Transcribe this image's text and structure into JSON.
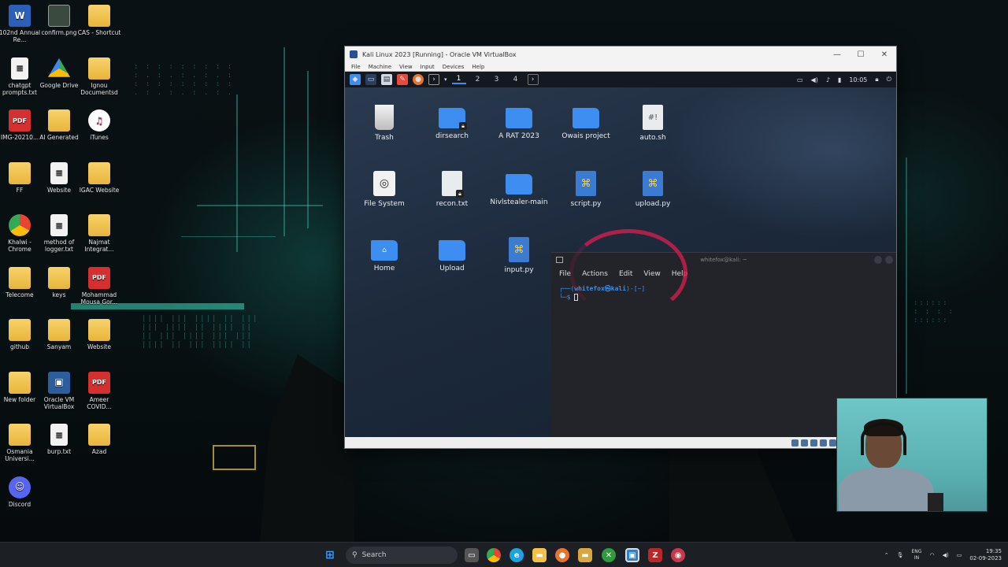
{
  "desktop_icons": [
    {
      "label": "102nd Annual Re...",
      "type": "word"
    },
    {
      "label": "confirm.png",
      "type": "img"
    },
    {
      "label": "CAS - Shortcut",
      "type": "folder"
    },
    {
      "label": "chatgpt prompts.txt",
      "type": "file"
    },
    {
      "label": "Google Drive",
      "type": "drive"
    },
    {
      "label": "Ignou Documentsd",
      "type": "folder"
    },
    {
      "label": "IMG-20210...",
      "type": "pdf"
    },
    {
      "label": "AI Generated",
      "type": "folder"
    },
    {
      "label": "iTunes",
      "type": "itunes"
    },
    {
      "label": "FF",
      "type": "folder"
    },
    {
      "label": "Website",
      "type": "file"
    },
    {
      "label": "IGAC Website",
      "type": "folder"
    },
    {
      "label": "Khalwi - Chrome",
      "type": "chrome"
    },
    {
      "label": "method of logger.txt",
      "type": "file"
    },
    {
      "label": "Najmat Integrat...",
      "type": "folder"
    },
    {
      "label": "Telecome",
      "type": "folder"
    },
    {
      "label": "keys",
      "type": "folder"
    },
    {
      "label": "Mohammad Mousa Gor...",
      "type": "pdf"
    },
    {
      "label": "github",
      "type": "folder"
    },
    {
      "label": "Sanyam",
      "type": "folder"
    },
    {
      "label": "Website",
      "type": "folder"
    },
    {
      "label": "New folder",
      "type": "folder"
    },
    {
      "label": "Oracle VM VirtualBox",
      "type": "box"
    },
    {
      "label": "Ameer COVID...",
      "type": "pdf"
    },
    {
      "label": "Osmania Universi...",
      "type": "folder"
    },
    {
      "label": "burp.txt",
      "type": "file"
    },
    {
      "label": "Azad",
      "type": "folder"
    },
    {
      "label": "Discord",
      "type": "discord"
    }
  ],
  "vbox": {
    "title": "Kali Linux 2023 [Running] - Oracle VM VirtualBox",
    "menu": [
      "File",
      "Machine",
      "View",
      "Input",
      "Devices",
      "Help"
    ],
    "workspaces": [
      "1",
      "2",
      "3",
      "4"
    ],
    "clock": "10:05"
  },
  "kali_icons": [
    {
      "label": "Trash",
      "type": "trash"
    },
    {
      "label": "dirsearch",
      "type": "folder-lock"
    },
    {
      "label": "A RAT 2023",
      "type": "folder"
    },
    {
      "label": "Owais project",
      "type": "folder"
    },
    {
      "label": "auto.sh",
      "type": "file"
    },
    {
      "label": "File System",
      "type": "disk"
    },
    {
      "label": "recon.txt",
      "type": "file-lock"
    },
    {
      "label": "Nivlstealer-main",
      "type": "folder"
    },
    {
      "label": "script.py",
      "type": "py"
    },
    {
      "label": "upload.py",
      "type": "py"
    },
    {
      "label": "Home",
      "type": "home"
    },
    {
      "label": "Upload",
      "type": "folder"
    },
    {
      "label": "input.py",
      "type": "py"
    }
  ],
  "terminal": {
    "title": "whitefox@kali: ~",
    "menu": [
      "File",
      "Actions",
      "Edit",
      "View",
      "Help"
    ],
    "prompt_open": "┌──(",
    "user": "whitefox㉿kali",
    "prompt_dir": ")-[~]",
    "prompt_line2": "└─$ "
  },
  "taskbar": {
    "search_placeholder": "Search",
    "lang_top": "ENG",
    "lang_bottom": "IN",
    "time": "19:35",
    "date": "02-09-2023"
  }
}
